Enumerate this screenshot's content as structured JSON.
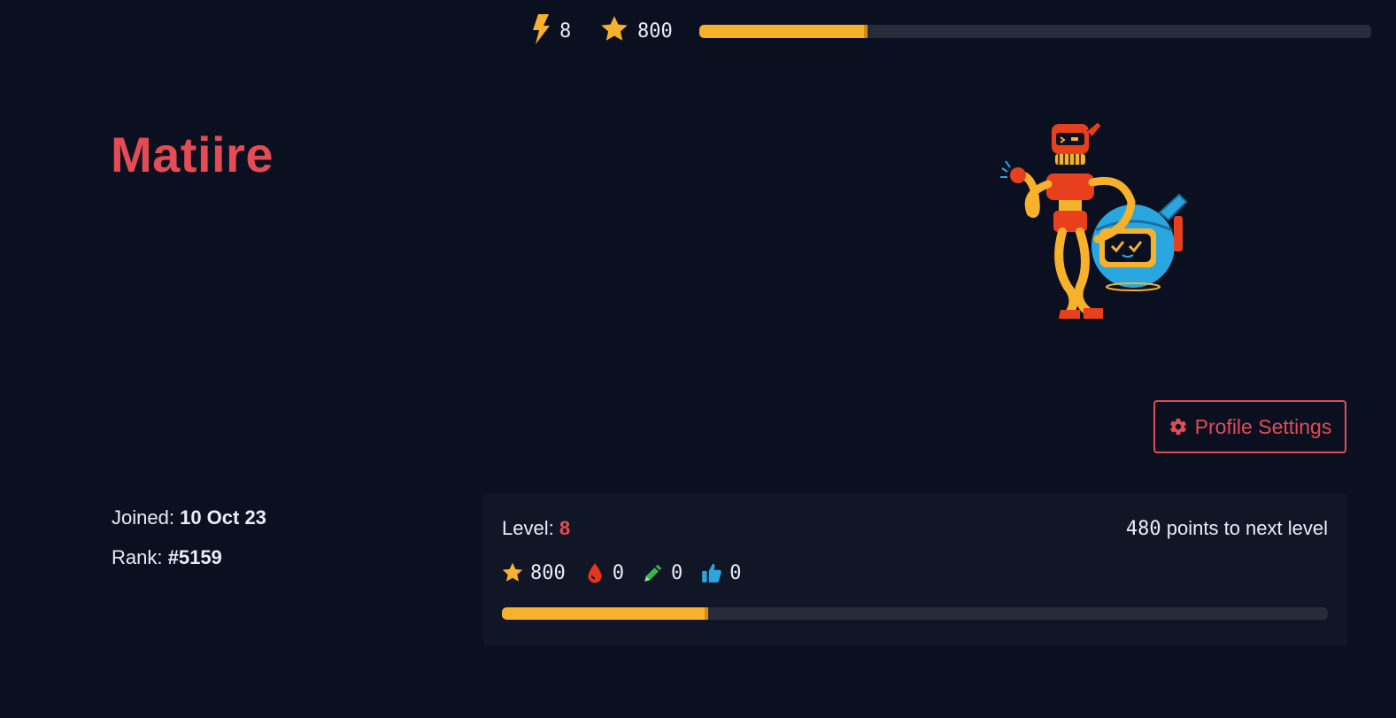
{
  "topbar": {
    "level": "8",
    "points": "800",
    "progress_percent": 25,
    "icons": {
      "level": "lightning-icon",
      "points": "star-icon"
    }
  },
  "profile": {
    "username": "Matiire",
    "avatar": "robot-illustration"
  },
  "settings_button": {
    "label": "Profile Settings",
    "icon": "gear-icon"
  },
  "meta": {
    "joined_label": "Joined:",
    "joined_value": "10 Oct 23",
    "rank_label": "Rank:",
    "rank_value": "#5159"
  },
  "level_card": {
    "level_label": "Level:",
    "level_value": "8",
    "points_to_next": "480",
    "points_to_next_text": "points to next level",
    "stats": [
      {
        "icon": "star-icon",
        "value": "800"
      },
      {
        "icon": "blood-drop-icon",
        "value": "0"
      },
      {
        "icon": "pencil-icon",
        "value": "0"
      },
      {
        "icon": "thumbs-up-icon",
        "value": "0"
      }
    ],
    "progress_percent": 25
  },
  "colors": {
    "background": "#0b1020",
    "card": "#111626",
    "accent_red": "#e44c55",
    "accent_yellow": "#f7b12a",
    "track": "#262c3a"
  }
}
